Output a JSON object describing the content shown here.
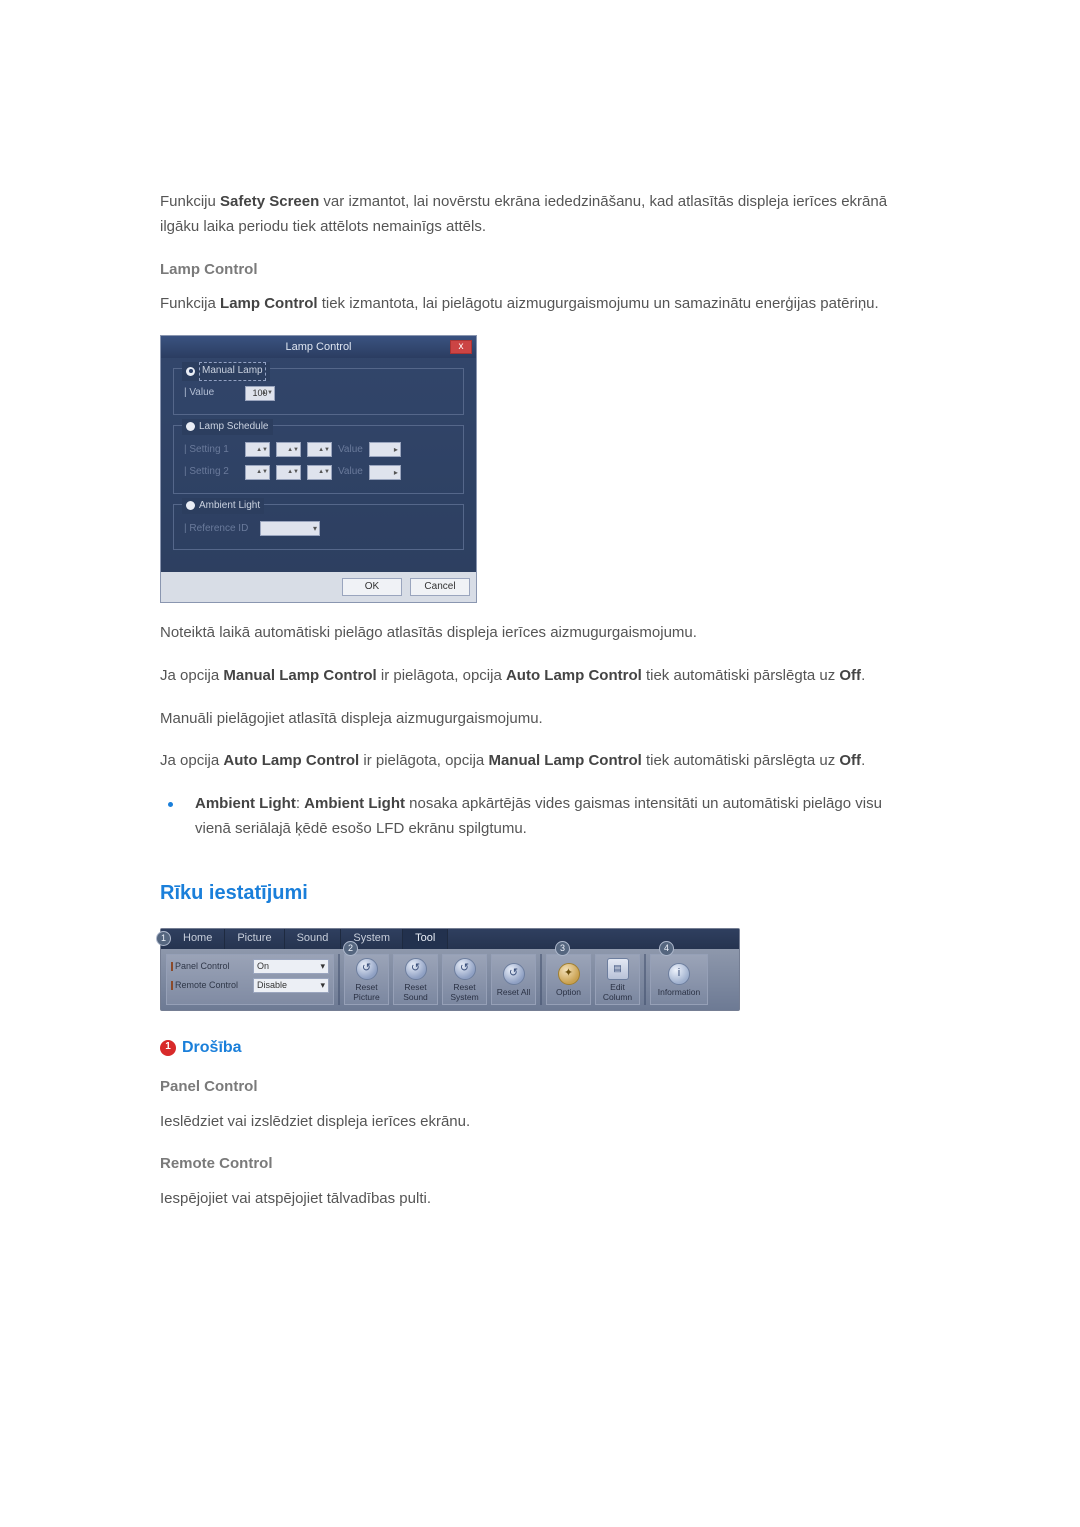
{
  "intro": {
    "p1_a": "Funkciju ",
    "p1_b": "Safety Screen",
    "p1_c": " var izmantot, lai novērstu ekrāna iededzināšanu, kad atlasītās displeja ierīces ekrānā ilgāku laika periodu tiek attēlots nemainīgs attēls."
  },
  "lamp": {
    "heading": "Lamp Control",
    "p_a": "Funkcija ",
    "p_b": "Lamp Control",
    "p_c": " tiek izmantota, lai pielāgotu aizmugurgaismojumu un samazinātu enerģijas patēriņu."
  },
  "dlg": {
    "title": "Lamp Control",
    "close": "x",
    "manual": {
      "legend": "Manual Lamp",
      "value_label": "| Value",
      "value": "100"
    },
    "schedule": {
      "legend": "Lamp Schedule",
      "s1": "| Setting 1",
      "s2": "| Setting 2",
      "value_label": "Value"
    },
    "ambient": {
      "legend": "Ambient Light",
      "ref": "| Reference ID"
    },
    "ok": "OK",
    "cancel": "Cancel"
  },
  "after_dlg": {
    "p1": "Noteiktā laikā automātiski pielāgo atlasītās displeja ierīces aizmugurgaismojumu.",
    "p2_a": "Ja opcija ",
    "p2_b": "Manual Lamp Control",
    "p2_c": " ir pielāgota, opcija ",
    "p2_d": "Auto Lamp Control",
    "p2_e": " tiek automātiski pārslēgta uz ",
    "p2_f": "Off",
    "p2_g": ".",
    "p3": "Manuāli pielāgojiet atlasītā displeja aizmugurgaismojumu.",
    "p4_a": "Ja opcija ",
    "p4_b": "Auto Lamp Control",
    "p4_c": " ir pielāgota, opcija ",
    "p4_d": "Manual Lamp Control",
    "p4_e": " tiek automātiski pārslēgta uz ",
    "p4_f": "Off",
    "p4_g": "."
  },
  "bullet": {
    "b1": "Ambient Light",
    "b2": ": ",
    "b3": "Ambient Light",
    "b4": " nosaka apkārtējās vides gaismas intensitāti un automātiski pielāgo visu vienā seriālajā ķēdē esošo LFD ekrānu spilgtumu."
  },
  "tools": {
    "heading": "Rīku iestatījumi",
    "tabs": {
      "home": "Home",
      "picture": "Picture",
      "sound": "Sound",
      "system": "System",
      "tool": "Tool"
    },
    "badges": {
      "b1": "1",
      "b2": "2",
      "b3": "3",
      "b4": "4"
    },
    "panel": {
      "label": "Panel Control",
      "value": "On"
    },
    "remote": {
      "label": "Remote Control",
      "value": "Disable"
    },
    "btns": {
      "rp": "Reset Picture",
      "rs": "Reset Sound",
      "rsy": "Reset System",
      "ra": "Reset All",
      "opt": "Option",
      "edit": "Edit Column",
      "info": "Information"
    }
  },
  "security": {
    "num": "1",
    "title": "Drošība",
    "panel_h": "Panel Control",
    "panel_p": "Ieslēdziet vai izslēdziet displeja ierīces ekrānu.",
    "remote_h": "Remote Control",
    "remote_p": "Iespējojiet vai atspējojiet tālvadības pulti."
  }
}
